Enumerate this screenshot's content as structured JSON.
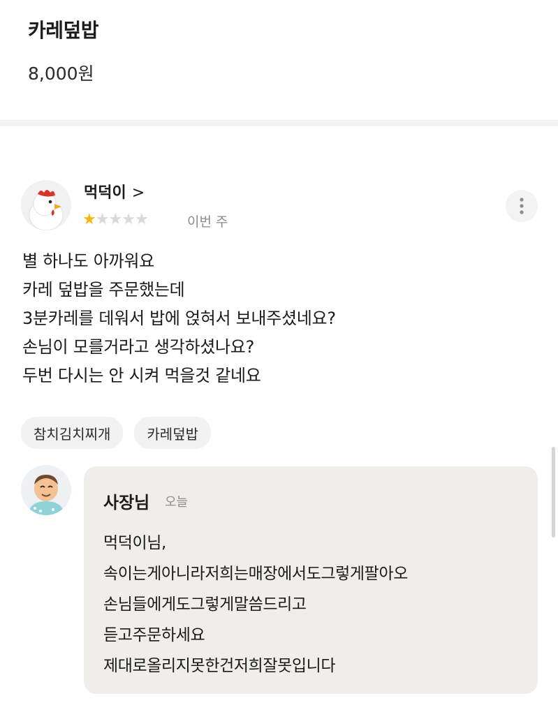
{
  "menu": {
    "name": "카레덮밥",
    "price": "8,000원"
  },
  "review": {
    "author": "먹덕이",
    "author_chevron": ">",
    "rating": 1,
    "rating_max": 5,
    "date": "이번 주",
    "lines": [
      "별 하나도 아까워요",
      "카레 덮밥을 주문했는데",
      "3분카레를 데워서 밥에 얹혀서 보내주셨네요?",
      "손님이 모를거라고 생각하셨나요?",
      "두번 다시는 안 시켜 먹을것 같네요"
    ],
    "tags": [
      "참치김치찌개",
      "카레덮밥"
    ],
    "avatar_icon": "chicken-avatar-icon",
    "more_icon": "more-vertical-icon"
  },
  "reply": {
    "author": "사장님",
    "date": "오늘",
    "lines": [
      "먹덕이님,",
      "속이는게아니라저희는매장에서도그렇게팔아오",
      "손님들에게도그렇게말씀드리고",
      "듣고주문하세요",
      "제대로올리지못한건저희잘못입니다"
    ],
    "avatar_icon": "owner-avatar-icon"
  },
  "colors": {
    "star_on": "#f5b70a",
    "star_off": "#d8d8d8",
    "reply_bg": "#f0eeea",
    "tag_bg": "#f2f2f2"
  }
}
